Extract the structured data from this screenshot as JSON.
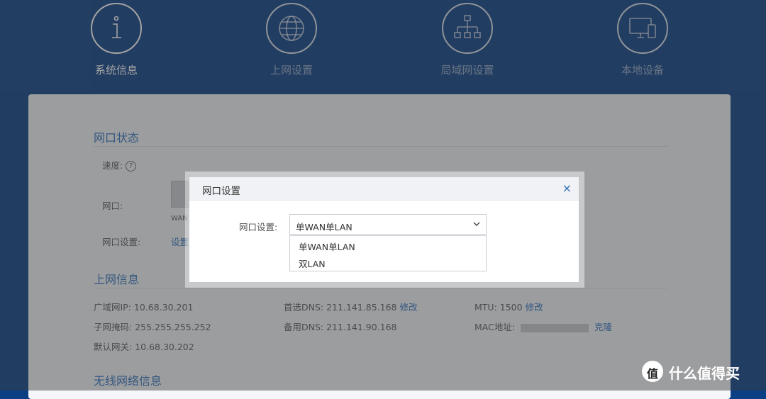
{
  "nav": {
    "items": [
      {
        "label": "系统信息",
        "icon": "info-icon",
        "active": true
      },
      {
        "label": "上网设置",
        "icon": "globe-icon",
        "active": false
      },
      {
        "label": "局域网设置",
        "icon": "network-tree-icon",
        "active": false
      },
      {
        "label": "本地设备",
        "icon": "devices-icon",
        "active": false
      }
    ]
  },
  "port_status": {
    "title": "网口状态",
    "speed_label": "速度:",
    "port_label": "网口:",
    "port_caption": "WAN",
    "port_setting_label": "网口设置:",
    "port_setting_link": "设置"
  },
  "internet_info": {
    "title": "上网信息",
    "wan_ip_label": "广域网IP:",
    "wan_ip": "10.68.30.201",
    "subnet_label": "子网掩码:",
    "subnet": "255.255.255.252",
    "gateway_label": "默认网关:",
    "gateway": "10.68.30.202",
    "dns1_label": "首选DNS:",
    "dns1": "211.141.85.168",
    "dns2_label": "备用DNS:",
    "dns2": "211.141.90.168",
    "edit": "修改",
    "mtu_label": "MTU:",
    "mtu": "1500",
    "mac_label": "MAC地址:",
    "clone": "克隆"
  },
  "wireless_info": {
    "title": "无线网络信息"
  },
  "modal": {
    "title": "网口设置",
    "close": "×",
    "field_label": "网口设置:",
    "selected": "单WAN单LAN",
    "options": [
      "单WAN单LAN",
      "双LAN"
    ]
  },
  "watermark": {
    "logo": "值",
    "text": "什么值得买"
  },
  "colors": {
    "header_bg": "#0b3f84",
    "accent": "#2e6fbd"
  }
}
